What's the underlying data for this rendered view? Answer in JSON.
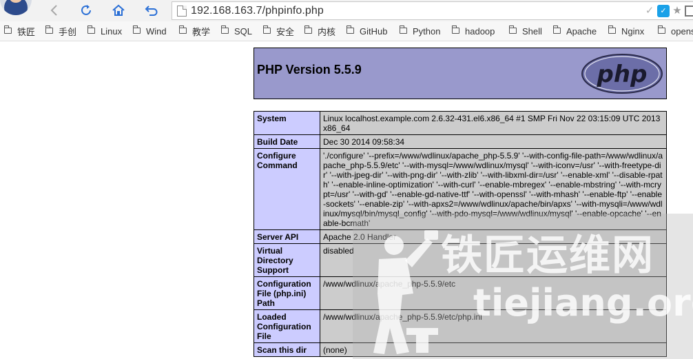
{
  "browser": {
    "url": "192.168.163.7/phpinfo.php",
    "bookmarks": [
      "铁匠",
      "手创",
      "Linux",
      "Wind",
      "教学",
      "SQL",
      "安全",
      "内核",
      "GitHub",
      "Python",
      "hadoop",
      "Shell",
      "Apache",
      "Nginx",
      "opens"
    ]
  },
  "php": {
    "version_title": "PHP Version 5.5.9",
    "logo_text": "php",
    "rows": [
      {
        "key": "System",
        "value": "Linux localhost.example.com 2.6.32-431.el6.x86_64 #1 SMP Fri Nov 22 03:15:09 UTC 2013 x86_64"
      },
      {
        "key": "Build Date",
        "value": "Dec 30 2014 09:58:34"
      },
      {
        "key": "Configure Command",
        "value": "'./configure' '--prefix=/www/wdlinux/apache_php-5.5.9' '--with-config-file-path=/www/wdlinux/apache_php-5.5.9/etc' '--with-mysql=/www/wdlinux/mysql' '--with-iconv=/usr' '--with-freetype-dir' '--with-jpeg-dir' '--with-png-dir' '--with-zlib' '--with-libxml-dir=/usr' '--enable-xml' '--disable-rpath' '--enable-inline-optimization' '--with-curl' '--enable-mbregex' '--enable-mbstring' '--with-mcrypt=/usr' '--with-gd' '--enable-gd-native-ttf' '--with-openssl' '--with-mhash' '--enable-ftp' '--enable-sockets' '--enable-zip' '--with-apxs2=/www/wdlinux/apache/bin/apxs' '--with-mysqli=/www/wdlinux/mysql/bin/mysql_config' '--with-pdo-mysql=/www/wdlinux/mysql' '--enable-opcache' '--enable-bcmath'"
      },
      {
        "key": "Server API",
        "value": "Apache 2.0 Handler"
      },
      {
        "key": "Virtual Directory Support",
        "value": "disabled"
      },
      {
        "key": "Configuration File (php.ini) Path",
        "value": "/www/wdlinux/apache_php-5.5.9/etc"
      },
      {
        "key": "Loaded Configuration File",
        "value": "/www/wdlinux/apache_php-5.5.9/etc/php.ini"
      },
      {
        "key": "Scan this dir",
        "value": "(none)"
      }
    ]
  },
  "watermark": {
    "title": "铁匠运维网",
    "site": "tiejiang.org"
  }
}
